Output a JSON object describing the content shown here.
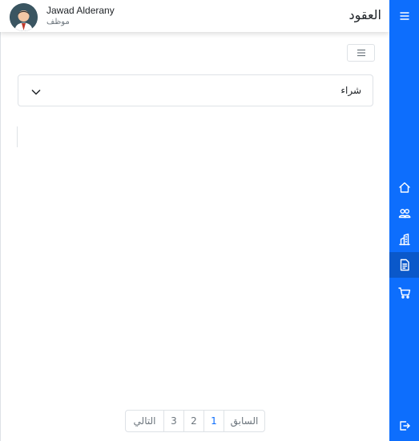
{
  "header": {
    "title": "العقود",
    "user_name": "Jawad Alderany",
    "user_role": "موظف"
  },
  "filter": {
    "accordion_label": "شراء"
  },
  "pagination": {
    "next_label": "التالي",
    "pages": [
      "3",
      "2",
      "1"
    ],
    "prev_label": "السابق",
    "current_page": "1"
  },
  "sidebar": {
    "items": [
      {
        "icon": "menu-icon"
      },
      {
        "icon": "home-icon"
      },
      {
        "icon": "users-icon"
      },
      {
        "icon": "building-icon"
      },
      {
        "icon": "contract-document-icon",
        "active": true
      },
      {
        "icon": "cart-icon"
      },
      {
        "icon": "logout-icon"
      }
    ]
  },
  "colors": {
    "sidebar": "#0d6efd",
    "sidebar_active": "#0a58ca",
    "active_page": "#0d6efd"
  }
}
